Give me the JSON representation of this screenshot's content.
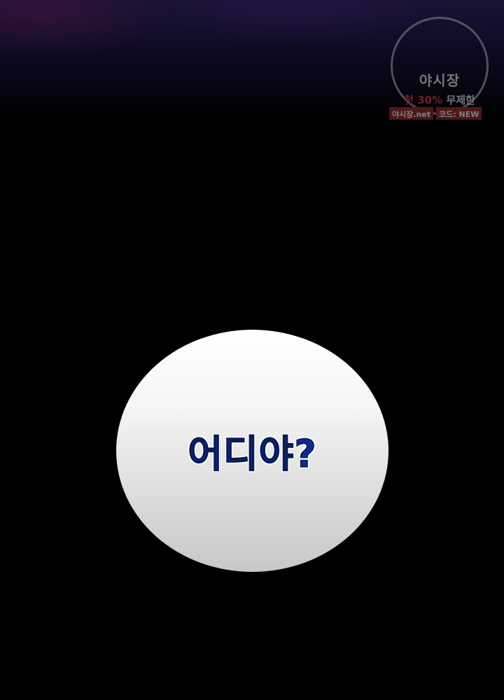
{
  "speech_bubble": {
    "text": "어디야?",
    "text_color": "#0d2a8f"
  },
  "watermark": {
    "title": "야시장",
    "promo_first": "첫",
    "promo_discount": "30%",
    "promo_rest": "무제한",
    "site": "야시장.net",
    "code": "코드: NEW",
    "accent_color": "#c43a3a"
  }
}
